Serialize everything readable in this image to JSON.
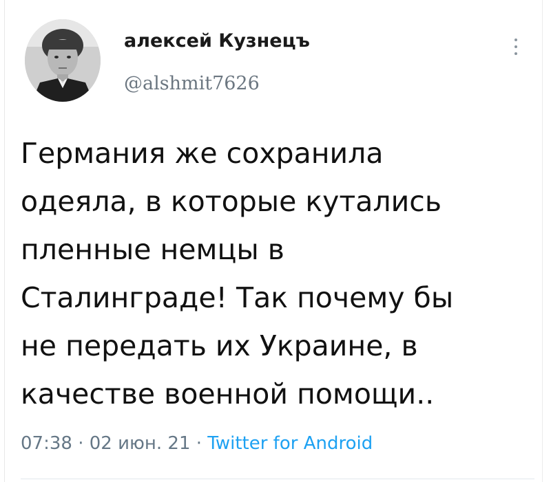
{
  "author": {
    "display_name": "алексей Кузнецъ",
    "handle": "@alshmit7626",
    "avatar_alt": "avatar"
  },
  "tweet": {
    "lines": [
      "Германия же сохранила",
      "одеяла, в которые кутались",
      "пленные немцы в",
      "Сталинграде! Так почему бы",
      "не передать их Украине, в",
      "качестве военной помощи.."
    ]
  },
  "meta": {
    "time": "07:38",
    "separator": "·",
    "date": "02 июн. 21",
    "source": "Twitter for Android"
  },
  "icons": {
    "more": "more-vertical-icon"
  },
  "colors": {
    "link": "#1da1f2",
    "secondary": "#657786"
  }
}
